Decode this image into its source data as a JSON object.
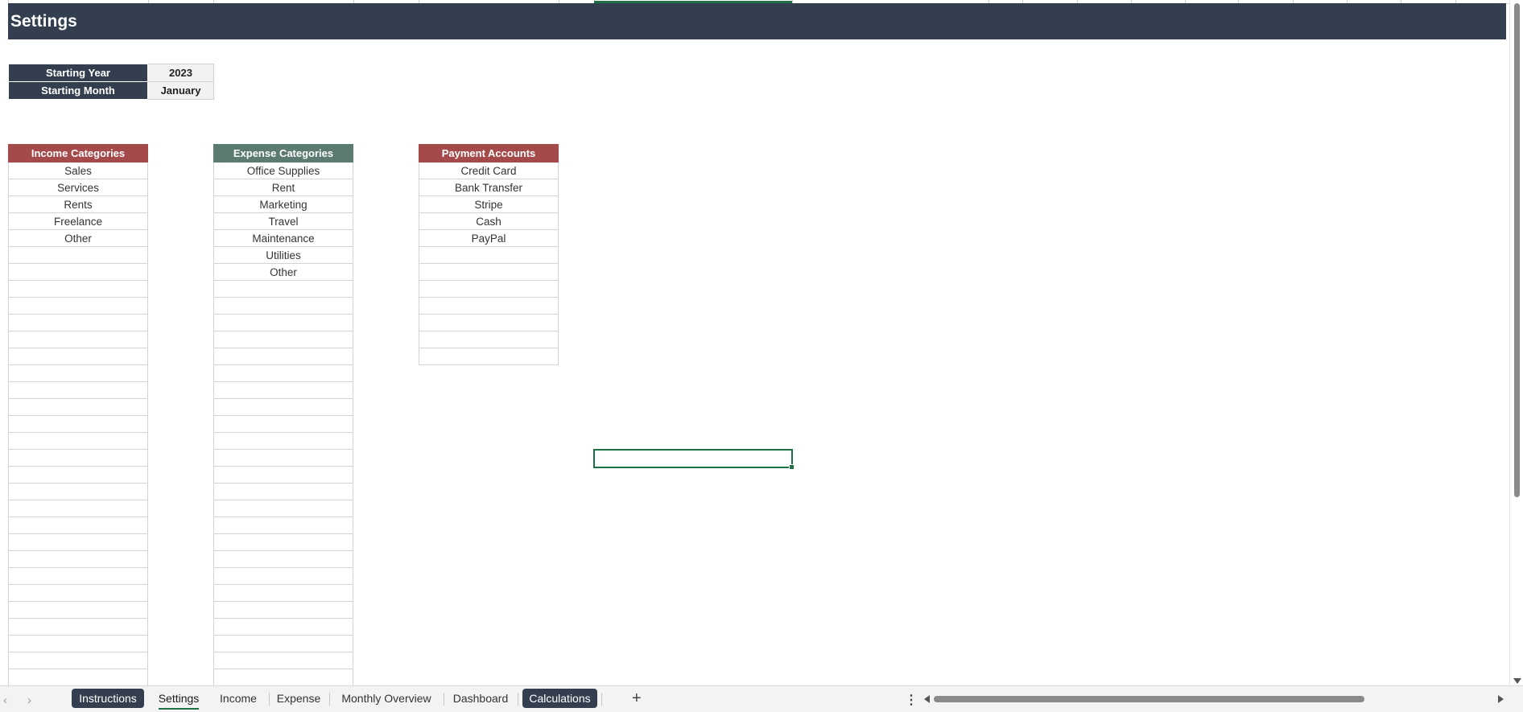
{
  "title": "Settings",
  "settings": {
    "starting_year_label": "Starting Year",
    "starting_year_value": "2023",
    "starting_month_label": "Starting Month",
    "starting_month_value": "January"
  },
  "income": {
    "header": "Income Categories",
    "color": "#a54a4a",
    "items": [
      "Sales",
      "Services",
      "Rents",
      "Freelance",
      "Other"
    ]
  },
  "expense": {
    "header": "Expense Categories",
    "color": "#5a7a72",
    "items": [
      "Office Supplies",
      "Rent",
      "Marketing",
      "Travel",
      "Maintenance",
      "Utilities",
      "Other"
    ]
  },
  "payment": {
    "header": "Payment Accounts",
    "color": "#a54a4a",
    "items": [
      "Credit Card",
      "Bank Transfer",
      "Stripe",
      "Cash",
      "PayPal"
    ]
  },
  "tabs": {
    "instructions": "Instructions",
    "settings": "Settings",
    "income": "Income",
    "expense": "Expense",
    "monthly_overview": "Monthly Overview",
    "dashboard": "Dashboard",
    "calculations": "Calculations",
    "add": "+",
    "more": "⋮",
    "prev": "‹",
    "next": "›"
  },
  "colors": {
    "header_dark": "#333f4f",
    "selection_green": "#1e7145"
  }
}
